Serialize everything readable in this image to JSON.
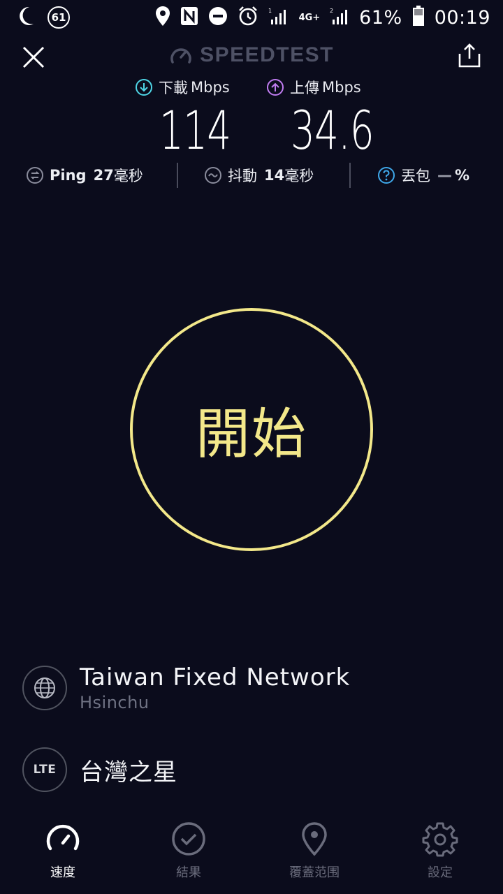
{
  "status_bar": {
    "badge": "61",
    "battery_percent": "61%",
    "time": "00:19",
    "net_type": "4G+",
    "icons": [
      "moon-icon",
      "location-icon",
      "nfc-icon",
      "dnd-icon",
      "alarm-icon",
      "signal-icon",
      "battery-icon"
    ]
  },
  "header": {
    "logo_text": "SPEEDTEST"
  },
  "download": {
    "label": "下載",
    "unit": "Mbps",
    "value": "114"
  },
  "upload": {
    "label": "上傳",
    "unit": "Mbps",
    "value": "34.6"
  },
  "stats": {
    "ping": {
      "label": "Ping",
      "value": "27",
      "unit": "毫秒"
    },
    "jitter": {
      "label": "抖動",
      "value": "14",
      "unit": "毫秒"
    },
    "loss": {
      "label": "丟包",
      "value": "—",
      "unit": "%"
    }
  },
  "go_button": {
    "label": "開始"
  },
  "server": {
    "name": "Taiwan Fixed Network",
    "location": "Hsinchu"
  },
  "provider": {
    "badge": "LTE",
    "name": "台灣之星"
  },
  "tabs": [
    {
      "label": "速度",
      "icon": "speedometer-icon",
      "active": true
    },
    {
      "label": "結果",
      "icon": "check-circle-icon",
      "active": false
    },
    {
      "label": "覆蓋范围",
      "icon": "map-pin-icon",
      "active": false
    },
    {
      "label": "設定",
      "icon": "gear-icon",
      "active": false
    }
  ],
  "colors": {
    "background": "#0b0c1c",
    "accent_yellow": "#f3e88a",
    "download_cyan": "#4fd6e6",
    "upload_purple": "#c07cf0"
  }
}
